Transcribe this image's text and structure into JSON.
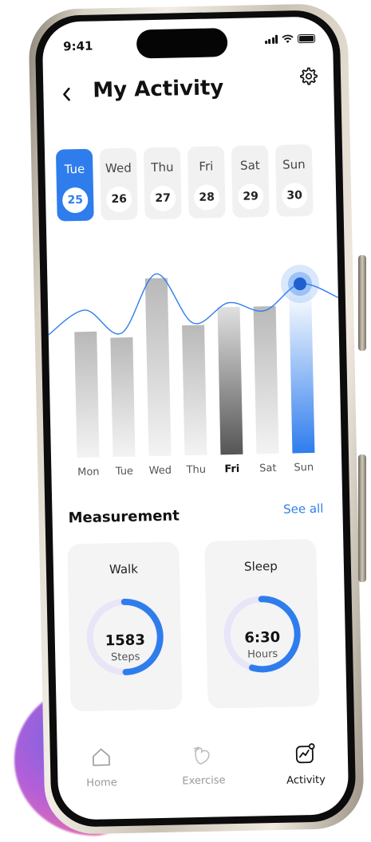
{
  "status": {
    "time": "9:41"
  },
  "header": {
    "title": "My Activity",
    "back_icon": "chevron-left-icon",
    "settings_icon": "gear-icon"
  },
  "days": [
    {
      "name": "Tue",
      "date": "25",
      "active": true
    },
    {
      "name": "Wed",
      "date": "26",
      "active": false
    },
    {
      "name": "Thu",
      "date": "27",
      "active": false
    },
    {
      "name": "Fri",
      "date": "28",
      "active": false
    },
    {
      "name": "Sat",
      "date": "29",
      "active": false
    },
    {
      "name": "Sun",
      "date": "30",
      "active": false
    }
  ],
  "chart_data": {
    "type": "bar",
    "categories": [
      "Mon",
      "Tue",
      "Wed",
      "Thu",
      "Fri",
      "Sat",
      "Sun"
    ],
    "values": [
      58,
      55,
      82,
      60,
      68,
      68,
      75
    ],
    "trend": [
      68,
      57,
      84,
      61,
      70,
      66,
      78
    ],
    "highlight": "Sun",
    "bold_category": "Fri",
    "ylim": [
      0,
      100
    ],
    "colors": {
      "highlight": "#2f7ded",
      "line": "#2f7ded"
    }
  },
  "measurement": {
    "title": "Measurement",
    "see_all": "See all",
    "cards": [
      {
        "label": "Walk",
        "value": "1583",
        "unit": "Steps",
        "progress": 0.5
      },
      {
        "label": "Sleep",
        "value": "6:30",
        "unit": "Hours",
        "progress": 0.55
      }
    ]
  },
  "tabs": [
    {
      "label": "Home",
      "icon": "home-icon",
      "active": false
    },
    {
      "label": "Exercise",
      "icon": "exercise-icon",
      "active": false
    },
    {
      "label": "Activity",
      "icon": "activity-icon",
      "active": true
    }
  ],
  "colors": {
    "accent": "#2f7ded",
    "ring_track": "#e9e4f7"
  }
}
